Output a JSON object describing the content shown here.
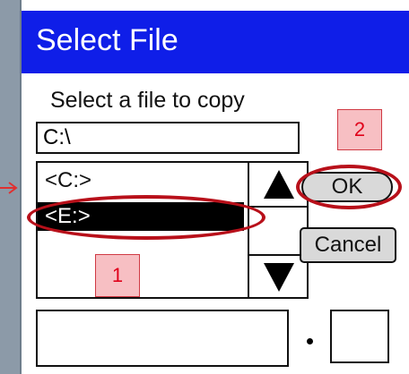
{
  "dialog": {
    "title": "Select File",
    "prompt": "Select a file to copy",
    "path_value": "C:\\",
    "list_items": [
      "<C:>",
      "<E:>"
    ],
    "selected_index": 1,
    "ok_label": "OK",
    "cancel_label": "Cancel",
    "filename_value": "",
    "extension_value": "",
    "extension_separator": "."
  },
  "annotations": {
    "callout_1": "1",
    "callout_2": "2"
  },
  "colors": {
    "title_bar": "#0f1ee8",
    "selection": "#000000",
    "highlight_ring": "#b8101a",
    "callout_fill": "#f7bfc3",
    "callout_text": "#e0001a",
    "arrow": "#e03030"
  },
  "icons": [
    "scroll-up-icon",
    "scroll-down-icon",
    "pointer-arrow-icon"
  ]
}
